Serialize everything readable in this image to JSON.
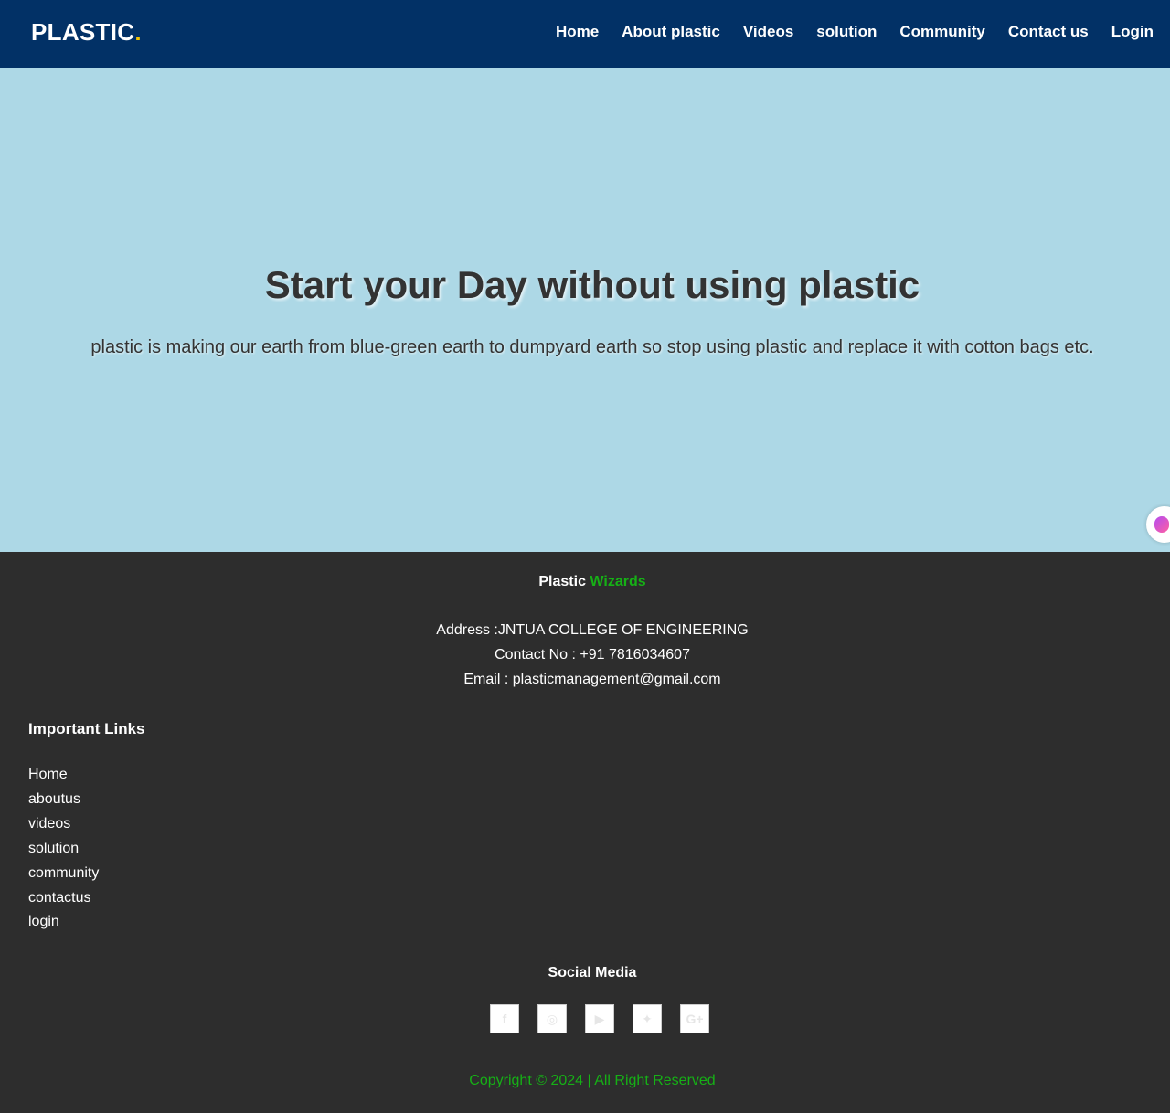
{
  "nav": {
    "brand": "PLASTIC",
    "brand_dot": ".",
    "links": [
      "Home",
      "About plastic",
      "Videos",
      "solution",
      "Community",
      "Contact us",
      "Login"
    ]
  },
  "hero": {
    "title": "Start your Day without using plastic",
    "subtitle": "plastic is making our earth from blue-green earth to dumpyard earth so stop using plastic and replace it with cotton bags etc."
  },
  "footer": {
    "brand_main": "Plastic",
    "brand_accent": "Wizards",
    "address": "Address :JNTUA COLLEGE OF ENGINEERING",
    "contact": "Contact No : +91 7816034607",
    "email": "Email : plasticmanagement@gmail.com",
    "links_title": "Important Links",
    "links": [
      "Home",
      "aboutus",
      "videos",
      "solution",
      "community",
      "contactus",
      "login"
    ],
    "social_title": "Social Media",
    "social_icons": [
      {
        "name": "facebook-icon",
        "glyph": "f"
      },
      {
        "name": "instagram-icon",
        "glyph": "◎"
      },
      {
        "name": "youtube-icon",
        "glyph": "▶"
      },
      {
        "name": "twitter-icon",
        "glyph": "✦"
      },
      {
        "name": "google-plus-icon",
        "glyph": "G+"
      }
    ],
    "copyright": "Copyright © 2024 | All Right Reserved"
  },
  "colors": {
    "navbar": "#023166",
    "hero": "#add8e6",
    "footer": "#2d2d2d",
    "accent_green": "#16b016",
    "brand_dot": "#f2c200"
  }
}
